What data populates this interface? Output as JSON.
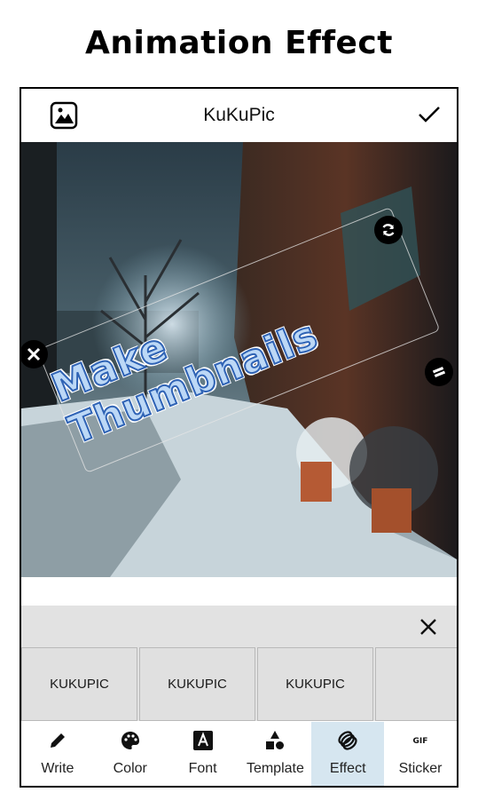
{
  "headline": "Animation Effect",
  "appbar": {
    "title": "KuKuPic",
    "gallery_icon": "image-gallery-icon",
    "done_icon": "checkmark-icon"
  },
  "canvas": {
    "sticker_text": "Make Thumbnails",
    "sticker_rotation_deg": -22,
    "handles": {
      "delete": "close-x-icon",
      "rotate": "rotate-arrows-icon",
      "resize": "resize-equals-icon"
    }
  },
  "effect_panel": {
    "close_icon": "close-x-icon",
    "presets": [
      "KUKUPIC",
      "KUKUPIC",
      "KUKUPIC",
      ""
    ]
  },
  "tabs": [
    {
      "label": "Write",
      "icon": "pencil-icon",
      "active": false
    },
    {
      "label": "Color",
      "icon": "palette-icon",
      "active": false
    },
    {
      "label": "Font",
      "icon": "font-a-icon",
      "active": false
    },
    {
      "label": "Template",
      "icon": "shapes-icon",
      "active": false
    },
    {
      "label": "Effect",
      "icon": "rings-icon",
      "active": true
    },
    {
      "label": "Sticker",
      "icon": "gif-icon",
      "active": false
    }
  ],
  "colors": {
    "active_tab_bg": "#d6e6f0",
    "panel_bg": "#e2e2e2",
    "sticker_fill": "#bcd8f6",
    "sticker_outline": "#2f63b5"
  }
}
